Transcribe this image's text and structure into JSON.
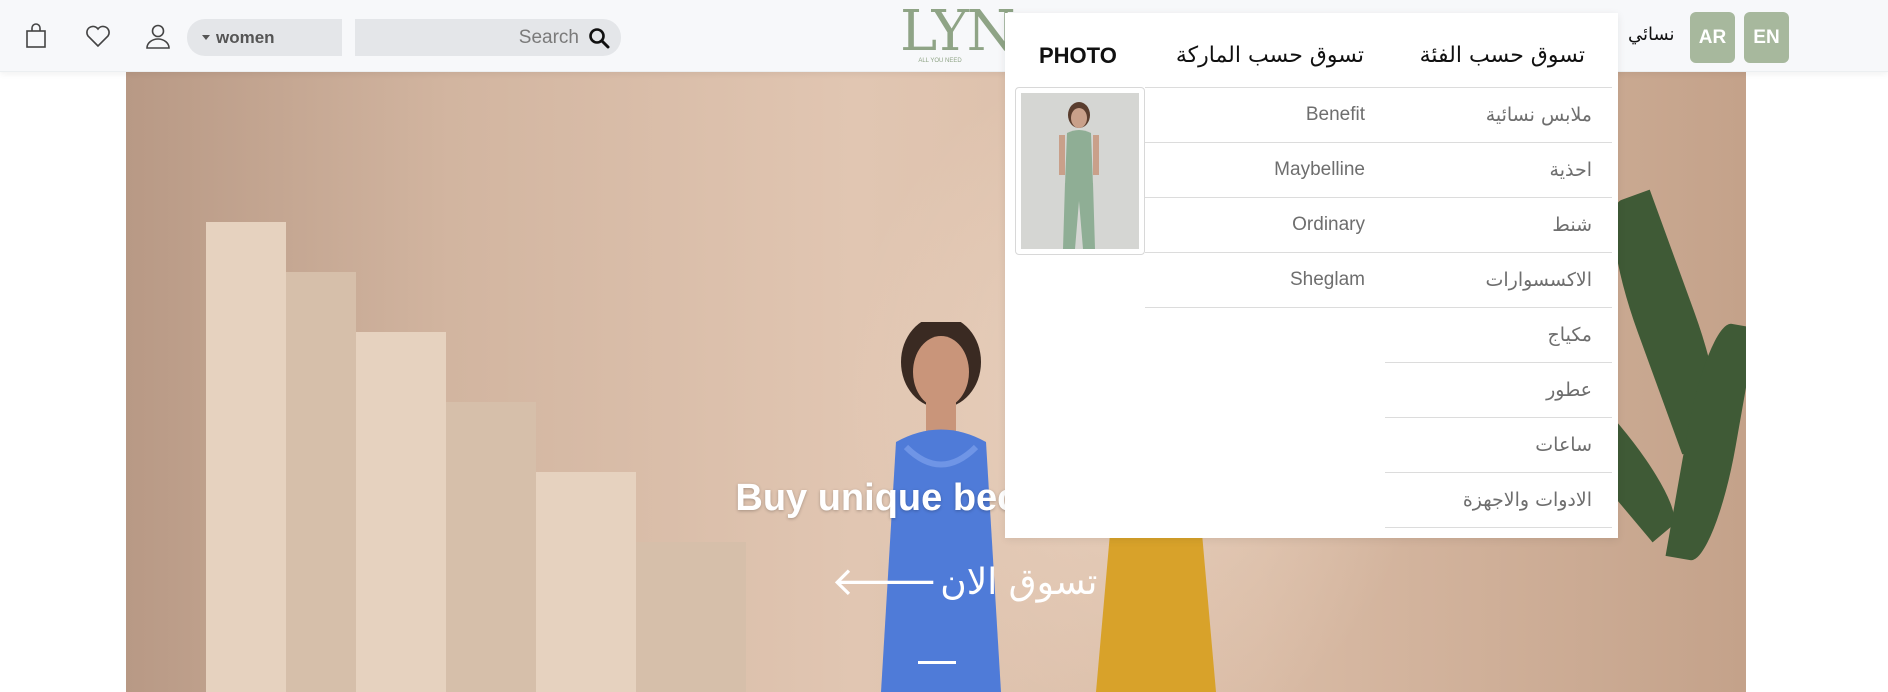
{
  "header": {
    "icons": {
      "cart": "shopping-bag-icon",
      "wishlist": "heart-icon",
      "account": "user-icon",
      "search": "search-icon"
    },
    "gender_select": {
      "value": "women"
    },
    "search": {
      "placeholder": "Search",
      "value": ""
    },
    "logo": {
      "mark": "LYN",
      "tagline": "ALL YOU NEED"
    },
    "nav": {
      "women_label": "نسائي"
    },
    "languages": [
      {
        "label": "AR"
      },
      {
        "label": "EN"
      }
    ]
  },
  "mega_menu": {
    "headers": {
      "by_category": "تسوق حسب الفئة",
      "by_brand": "تسوق حسب الماركة",
      "photo": "PHOTO"
    },
    "categories": [
      "ملابس نسائية",
      "احذية",
      "شنط",
      "الاكسسوارات",
      "مكياج",
      "عطور",
      "ساعات",
      "الادوات والاجهزة"
    ],
    "brands": [
      "Benefit",
      "Maybelline",
      "Ordinary",
      "Sheglam"
    ]
  },
  "hero": {
    "title": "Buy unique because y",
    "cta_label": "تسوق الان",
    "cta_arrow": "🡐"
  },
  "colors": {
    "accent": "#a7b89d",
    "logo": "#8fa486",
    "header_bg": "#f7f8fa",
    "input_bg": "#e4e6e9"
  }
}
